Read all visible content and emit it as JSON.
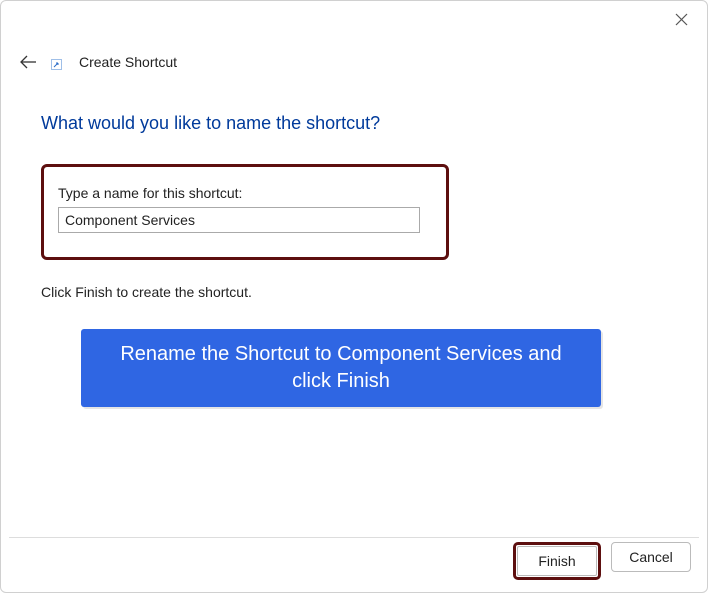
{
  "window": {
    "title": "Create Shortcut"
  },
  "main": {
    "question": "What would you like to name the shortcut?",
    "label": "Type a name for this shortcut:",
    "value": "Component Services",
    "helper": "Click Finish to create the shortcut."
  },
  "callout": {
    "text": "Rename the Shortcut to Component Services and click Finish"
  },
  "footer": {
    "finish": "Finish",
    "cancel": "Cancel"
  }
}
